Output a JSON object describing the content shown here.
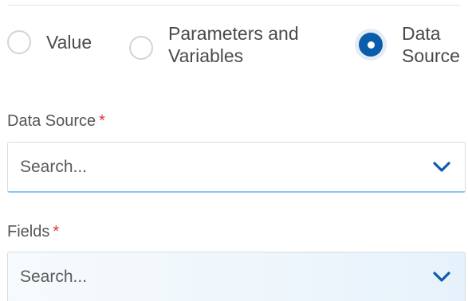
{
  "source_options": {
    "value_label": "Value",
    "params_label": "Parameters and Variables",
    "datasource_label": "Data Source",
    "selected": "datasource"
  },
  "data_source": {
    "label": "Data Source",
    "required_mark": "*",
    "placeholder": "Search..."
  },
  "fields": {
    "label": "Fields",
    "required_mark": "*",
    "placeholder": "Search..."
  },
  "colors": {
    "accent": "#0b5cab",
    "required": "#e2323a",
    "focus_underline": "#8cc6f0"
  },
  "icons": {
    "dropdown": "chevron-down-icon"
  }
}
